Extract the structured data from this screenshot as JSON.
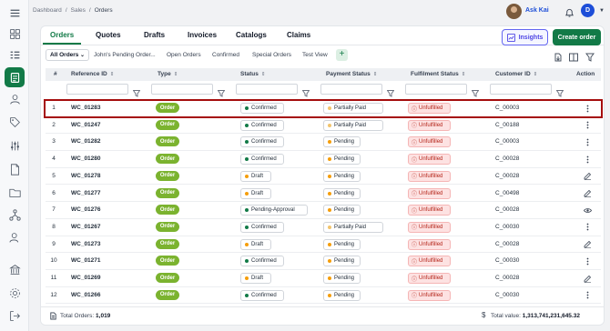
{
  "breadcrumb": [
    "Dashboard",
    "Sales",
    "Orders"
  ],
  "user": {
    "assistant_label": "Ask Kai",
    "initial": "D"
  },
  "main_tabs": [
    "Orders",
    "Quotes",
    "Drafts",
    "Invoices",
    "Catalogs",
    "Claims"
  ],
  "actions": {
    "insights_label": "Insights",
    "create_label": "Create order"
  },
  "views": {
    "selected": "All Orders",
    "chips": [
      "John's Pending Order...",
      "Open Orders",
      "Confirmed",
      "Special Orders",
      "Test View"
    ],
    "add_label": "+"
  },
  "table": {
    "columns": [
      "#",
      "Reference ID",
      "Type",
      "Status",
      "Payment Status",
      "Fulfilment Status",
      "Customer ID",
      "Action"
    ],
    "rows": [
      {
        "num": "1",
        "ref": "WC_01283",
        "type": "Order",
        "status": "Confirmed",
        "payment": "Partially Paid",
        "fulfil": "Unfulfilled",
        "customer": "C_00003",
        "action": "more"
      },
      {
        "num": "2",
        "ref": "WC_01247",
        "type": "Order",
        "status": "Confirmed",
        "payment": "Partially Paid",
        "fulfil": "Unfulfilled",
        "customer": "C_00188",
        "action": "more"
      },
      {
        "num": "3",
        "ref": "WC_01282",
        "type": "Order",
        "status": "Confirmed",
        "payment": "Pending",
        "fulfil": "Unfulfilled",
        "customer": "C_00003",
        "action": "more"
      },
      {
        "num": "4",
        "ref": "WC_01280",
        "type": "Order",
        "status": "Confirmed",
        "payment": "Pending",
        "fulfil": "Unfulfilled",
        "customer": "C_00028",
        "action": "more"
      },
      {
        "num": "5",
        "ref": "WC_01278",
        "type": "Order",
        "status": "Draft",
        "payment": "Pending",
        "fulfil": "Unfulfilled",
        "customer": "C_00028",
        "action": "edit"
      },
      {
        "num": "6",
        "ref": "WC_01277",
        "type": "Order",
        "status": "Draft",
        "payment": "Pending",
        "fulfil": "Unfulfilled",
        "customer": "C_00498",
        "action": "edit"
      },
      {
        "num": "7",
        "ref": "WC_01276",
        "type": "Order",
        "status": "Pending-Approval",
        "payment": "Pending",
        "fulfil": "Unfulfilled",
        "customer": "C_00028",
        "action": "view"
      },
      {
        "num": "8",
        "ref": "WC_01267",
        "type": "Order",
        "status": "Confirmed",
        "payment": "Partially Paid",
        "fulfil": "Unfulfilled",
        "customer": "C_00030",
        "action": "more"
      },
      {
        "num": "9",
        "ref": "WC_01273",
        "type": "Order",
        "status": "Draft",
        "payment": "Pending",
        "fulfil": "Unfulfilled",
        "customer": "C_00028",
        "action": "edit"
      },
      {
        "num": "10",
        "ref": "WC_01271",
        "type": "Order",
        "status": "Confirmed",
        "payment": "Pending",
        "fulfil": "Unfulfilled",
        "customer": "C_00030",
        "action": "more"
      },
      {
        "num": "11",
        "ref": "WC_01269",
        "type": "Order",
        "status": "Draft",
        "payment": "Pending",
        "fulfil": "Unfulfilled",
        "customer": "C_00028",
        "action": "edit"
      },
      {
        "num": "12",
        "ref": "WC_01266",
        "type": "Order",
        "status": "Confirmed",
        "payment": "Pending",
        "fulfil": "Unfulfilled",
        "customer": "C_00030",
        "action": "more"
      }
    ]
  },
  "status_colors": {
    "Confirmed": "#127a47",
    "Draft": "#f59e0b",
    "Pending-Approval": "#127a47",
    "Partially Paid": "#f2c46d",
    "Pending": "#f59e0b"
  },
  "colors": {
    "brand": "#127a47",
    "order_pill": "#7bb32f",
    "unfulfilled_bg": "#fde2e2",
    "highlight": "#a50d0d"
  },
  "footer": {
    "total_orders_label": "Total Orders:",
    "total_orders": "1,019",
    "total_value_label": "Total value:",
    "total_value": "1,313,741,231,645.32"
  }
}
